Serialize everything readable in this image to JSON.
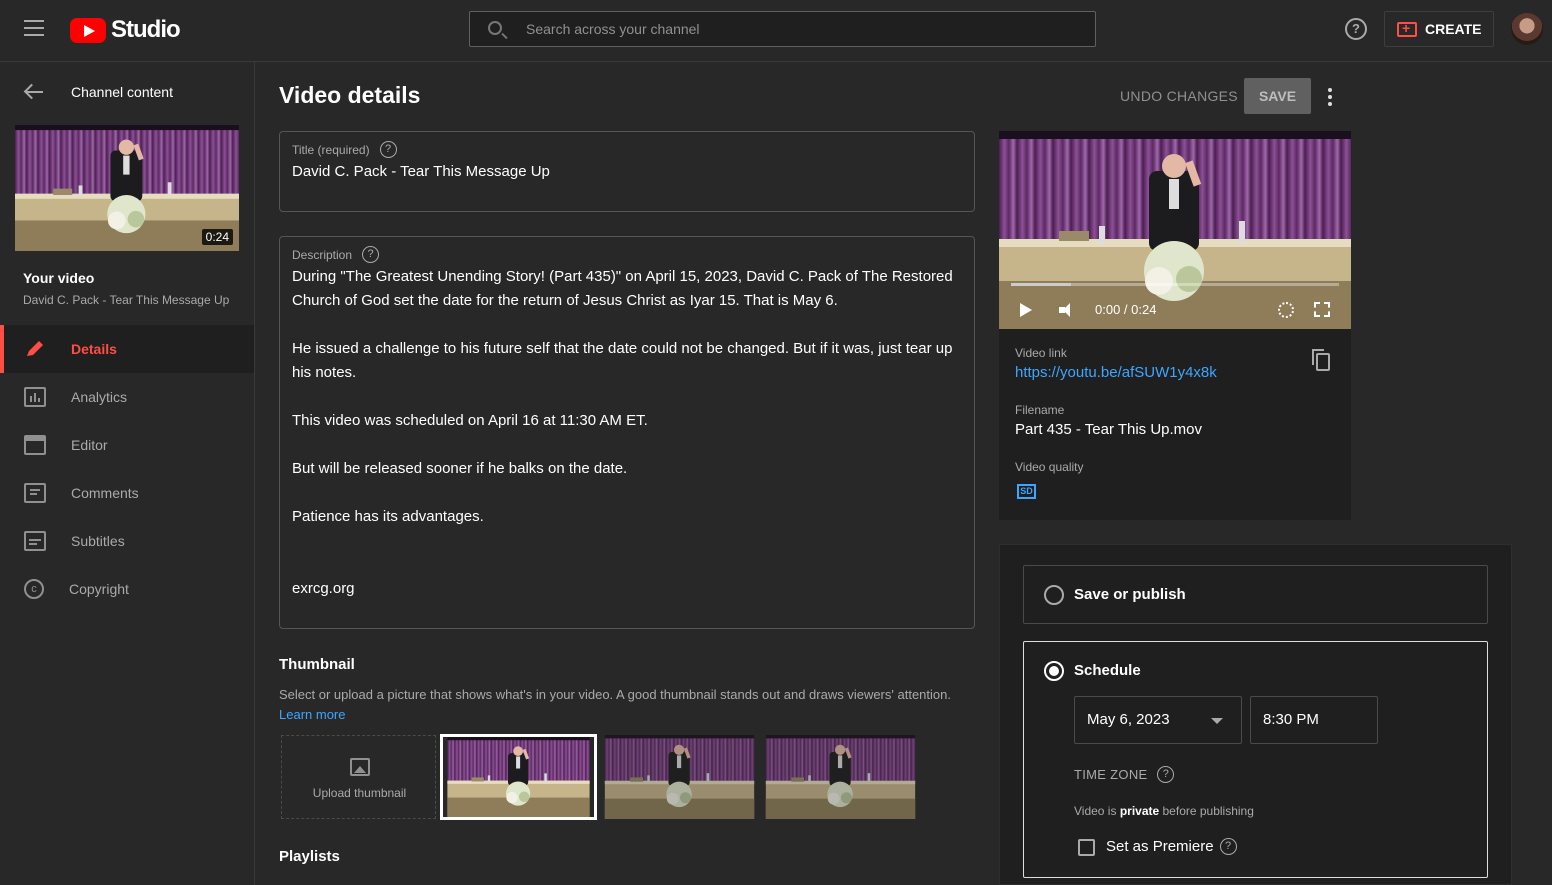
{
  "header": {
    "logo_text": "Studio",
    "search_placeholder": "Search across your channel",
    "help_glyph": "?",
    "create_label": "CREATE"
  },
  "sidebar": {
    "back_label": "Channel content",
    "thumb_duration": "0:24",
    "your_video_label": "Your video",
    "video_title": "David C. Pack - Tear This Message Up",
    "items": [
      {
        "label": "Details",
        "icon": "pencil-icon",
        "active": true
      },
      {
        "label": "Analytics",
        "icon": "analytics-icon",
        "active": false
      },
      {
        "label": "Editor",
        "icon": "editor-icon",
        "active": false
      },
      {
        "label": "Comments",
        "icon": "comments-icon",
        "active": false
      },
      {
        "label": "Subtitles",
        "icon": "subtitles-icon",
        "active": false
      },
      {
        "label": "Copyright",
        "icon": "copyright-icon",
        "active": false
      }
    ]
  },
  "main": {
    "page_title": "Video details",
    "undo_label": "UNDO CHANGES",
    "save_label": "SAVE",
    "title_field": {
      "label": "Title (required)",
      "value": "David C. Pack - Tear This Message Up"
    },
    "description_field": {
      "label": "Description",
      "paragraphs": [
        "During \"The Greatest Unending Story! (Part 435)\" on April 15, 2023, David C. Pack of The Restored Church of God set the date for the return of Jesus Christ as Iyar 15. That is May 6.",
        "He issued a challenge to his future self that the date could not be changed. But if it was, just tear up his notes.",
        "This video was scheduled on April 16 at 11:30 AM ET.",
        "But will be released sooner if he balks on the date.",
        "Patience has its advantages.",
        "exrcg.org"
      ]
    },
    "thumbnail": {
      "heading": "Thumbnail",
      "description": "Select or upload a picture that shows what's in your video. A good thumbnail stands out and draws viewers' attention.",
      "learn_more": "Learn more",
      "upload_label": "Upload thumbnail"
    },
    "playlists": {
      "heading": "Playlists"
    }
  },
  "right": {
    "player_time": "0:00 / 0:24",
    "video_link_label": "Video link",
    "video_link": "https://youtu.be/afSUW1y4x8k",
    "filename_label": "Filename",
    "filename": "Part 435 - Tear This Up.mov",
    "quality_label": "Video quality",
    "quality_badge": "SD",
    "visibility": {
      "save_publish_label": "Save or publish",
      "schedule_label": "Schedule",
      "date": "May 6, 2023",
      "time": "8:30 PM",
      "timezone_label": "TIME ZONE",
      "private_prefix": "Video is ",
      "private_word": "private",
      "private_suffix": " before publishing",
      "premiere_label": "Set as Premiere"
    }
  }
}
